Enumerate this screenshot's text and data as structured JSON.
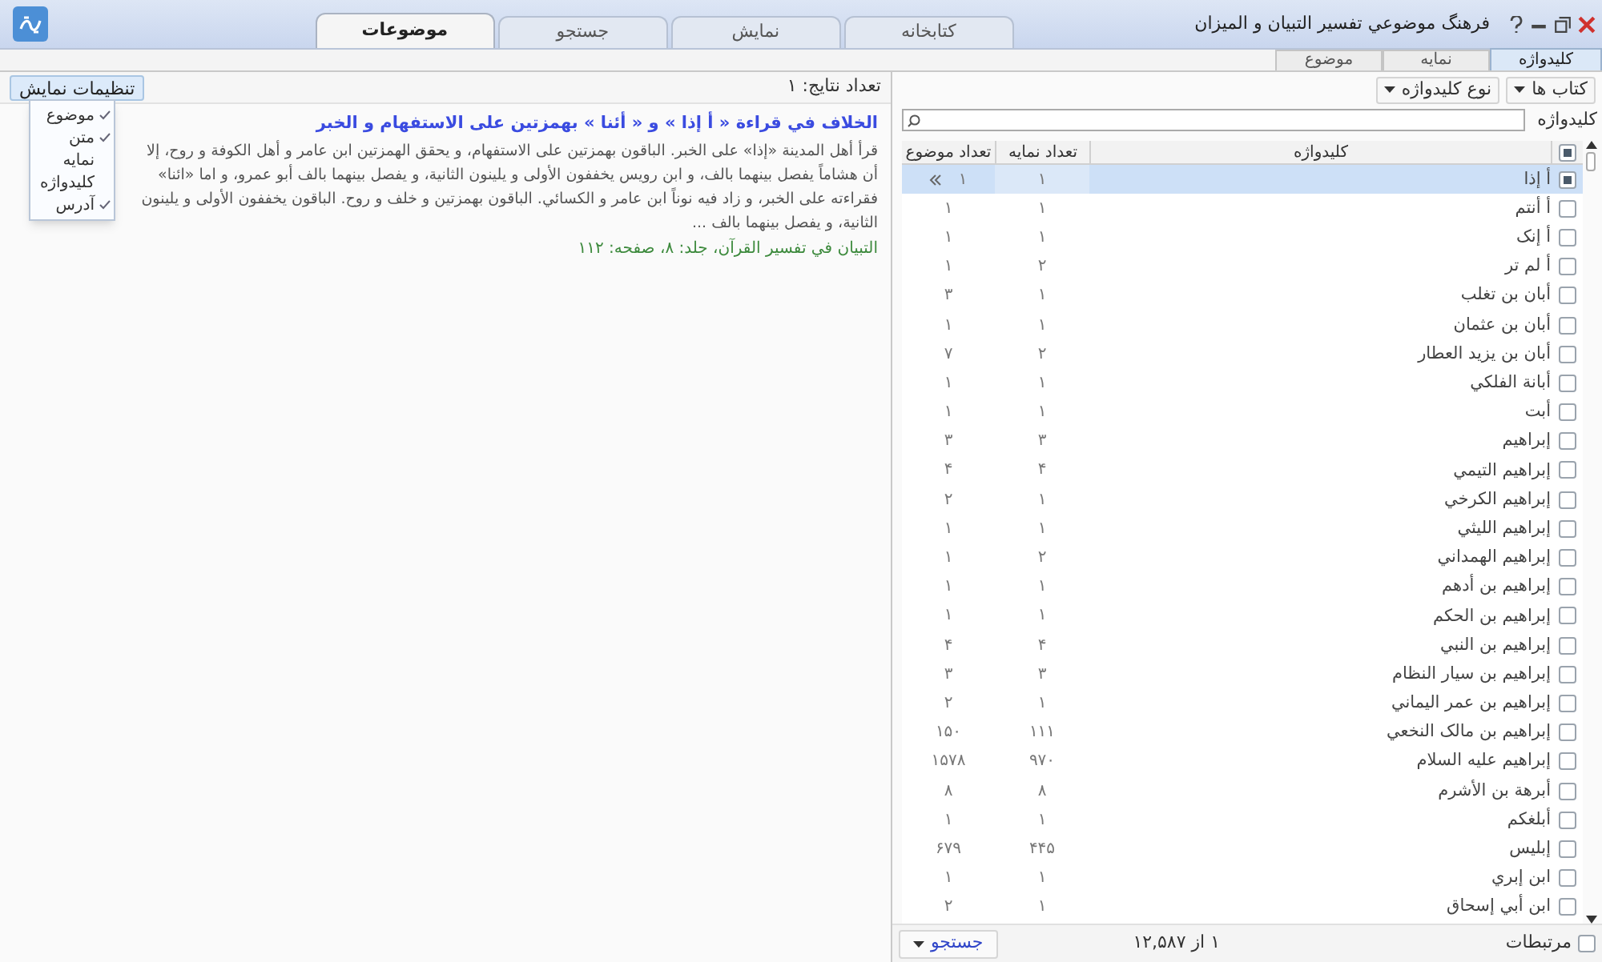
{
  "window": {
    "title": "فرهنگ موضوعي تفسير التبيان و الميزان"
  },
  "main_tabs": [
    {
      "label": "کتابخانه",
      "selected": false
    },
    {
      "label": "نمایش",
      "selected": false
    },
    {
      "label": "جستجو",
      "selected": false
    },
    {
      "label": "موضوعات",
      "selected": true
    }
  ],
  "sub_tabs": [
    {
      "label": "کلیدواژه",
      "selected": true
    },
    {
      "label": "نمایه",
      "selected": false
    },
    {
      "label": "موضوع",
      "selected": false
    }
  ],
  "filters": [
    "کتاب ها",
    "نوع کلیدواژه"
  ],
  "search": {
    "label": "کلیدواژه"
  },
  "table": {
    "select_all_checked": true,
    "columns": [
      "کلیدواژه",
      "تعداد نمایه",
      "تعداد موضوع"
    ],
    "rows": [
      {
        "keyword": "أ إذا",
        "index_count": "۱",
        "topic_count": "۱",
        "selected": true,
        "checked": true
      },
      {
        "keyword": "أ أنتم",
        "index_count": "۱",
        "topic_count": "۱",
        "selected": false,
        "checked": false
      },
      {
        "keyword": "أ إنک",
        "index_count": "۱",
        "topic_count": "۱",
        "selected": false,
        "checked": false
      },
      {
        "keyword": "أ لم تر",
        "index_count": "۲",
        "topic_count": "۱",
        "selected": false,
        "checked": false
      },
      {
        "keyword": "أبان بن تغلب",
        "index_count": "۱",
        "topic_count": "۳",
        "selected": false,
        "checked": false
      },
      {
        "keyword": "أبان بن عثمان",
        "index_count": "۱",
        "topic_count": "۱",
        "selected": false,
        "checked": false
      },
      {
        "keyword": "أبان بن يزيد العطار",
        "index_count": "۲",
        "topic_count": "۷",
        "selected": false,
        "checked": false
      },
      {
        "keyword": "أبانة الفلکي",
        "index_count": "۱",
        "topic_count": "۱",
        "selected": false,
        "checked": false
      },
      {
        "keyword": "أبت",
        "index_count": "۱",
        "topic_count": "۱",
        "selected": false,
        "checked": false
      },
      {
        "keyword": "إبراهيم",
        "index_count": "۳",
        "topic_count": "۳",
        "selected": false,
        "checked": false
      },
      {
        "keyword": "إبراهيم التيمي",
        "index_count": "۴",
        "topic_count": "۴",
        "selected": false,
        "checked": false
      },
      {
        "keyword": "إبراهيم الكرخي",
        "index_count": "۱",
        "topic_count": "۲",
        "selected": false,
        "checked": false
      },
      {
        "keyword": "إبراهيم الليثي",
        "index_count": "۱",
        "topic_count": "۱",
        "selected": false,
        "checked": false
      },
      {
        "keyword": "إبراهيم الهمداني",
        "index_count": "۲",
        "topic_count": "۱",
        "selected": false,
        "checked": false
      },
      {
        "keyword": "إبراهيم بن أدهم",
        "index_count": "۱",
        "topic_count": "۱",
        "selected": false,
        "checked": false
      },
      {
        "keyword": "إبراهيم بن الحکم",
        "index_count": "۱",
        "topic_count": "۱",
        "selected": false,
        "checked": false
      },
      {
        "keyword": "إبراهيم بن النبي",
        "index_count": "۴",
        "topic_count": "۴",
        "selected": false,
        "checked": false
      },
      {
        "keyword": "إبراهيم بن سيار النظام",
        "index_count": "۳",
        "topic_count": "۳",
        "selected": false,
        "checked": false
      },
      {
        "keyword": "إبراهيم بن عمر اليماني",
        "index_count": "۱",
        "topic_count": "۲",
        "selected": false,
        "checked": false
      },
      {
        "keyword": "إبراهيم بن مالک النخعي",
        "index_count": "۱۱۱",
        "topic_count": "۱۵۰",
        "selected": false,
        "checked": false
      },
      {
        "keyword": "إبراهيم عليه السلام",
        "index_count": "۹۷۰",
        "topic_count": "۱۵۷۸",
        "selected": false,
        "checked": false
      },
      {
        "keyword": "أبرهة بن الأشرم",
        "index_count": "۸",
        "topic_count": "۸",
        "selected": false,
        "checked": false
      },
      {
        "keyword": "أبلغکم",
        "index_count": "۱",
        "topic_count": "۱",
        "selected": false,
        "checked": false
      },
      {
        "keyword": "إبليس",
        "index_count": "۴۴۵",
        "topic_count": "۶۷۹",
        "selected": false,
        "checked": false
      },
      {
        "keyword": "ابن إبري",
        "index_count": "۱",
        "topic_count": "۱",
        "selected": false,
        "checked": false
      },
      {
        "keyword": "ابن أبي إسحاق",
        "index_count": "۱",
        "topic_count": "۲",
        "selected": false,
        "checked": false
      }
    ]
  },
  "footer": {
    "related": {
      "label": "مرتبطات",
      "checked": false
    },
    "pager": "۱ از ۱۲,۵۸۷",
    "search_button": "جستجو"
  },
  "results": {
    "count": "تعداد نتایج: ۱",
    "settings_button": "تنظیمات نمایش",
    "settings_menu": [
      {
        "label": "موضوع",
        "checked": true
      },
      {
        "label": "متن",
        "checked": true
      },
      {
        "label": "نمایه",
        "checked": false
      },
      {
        "label": "کلیدواژه",
        "checked": false
      },
      {
        "label": "آدرس",
        "checked": true
      }
    ],
    "items": [
      {
        "title": "الخلاف في قراءة « أ إذا » و « أئنا » بهمزتين على الاستفهام و الخبر",
        "text": "قرأ أهل المدينة «إذا» على الخبر. الباقون بهمزتين على الاستفهام، و يحقق الهمزتين ابن عامر و أهل الكوفة و روح، إلا أن هشاماً يفصل بينهما بالف، و ابن رويس يخففون الأولى و يلينون الثانية، و يفصل بينهما بالف أبو عمرو، و اما «ائنا» فقراءته على الخبر، و زاد فيه نوناً ابن عامر و الكسائي. الباقون بهمزتين و خلف و روح. الباقون يخففون الأولى و يلينون الثانية، و يفصل بينهما بالف ...",
        "source": "التبيان في تفسير القرآن، جلد: ۸، صفحه: ۱۱۲"
      }
    ]
  }
}
